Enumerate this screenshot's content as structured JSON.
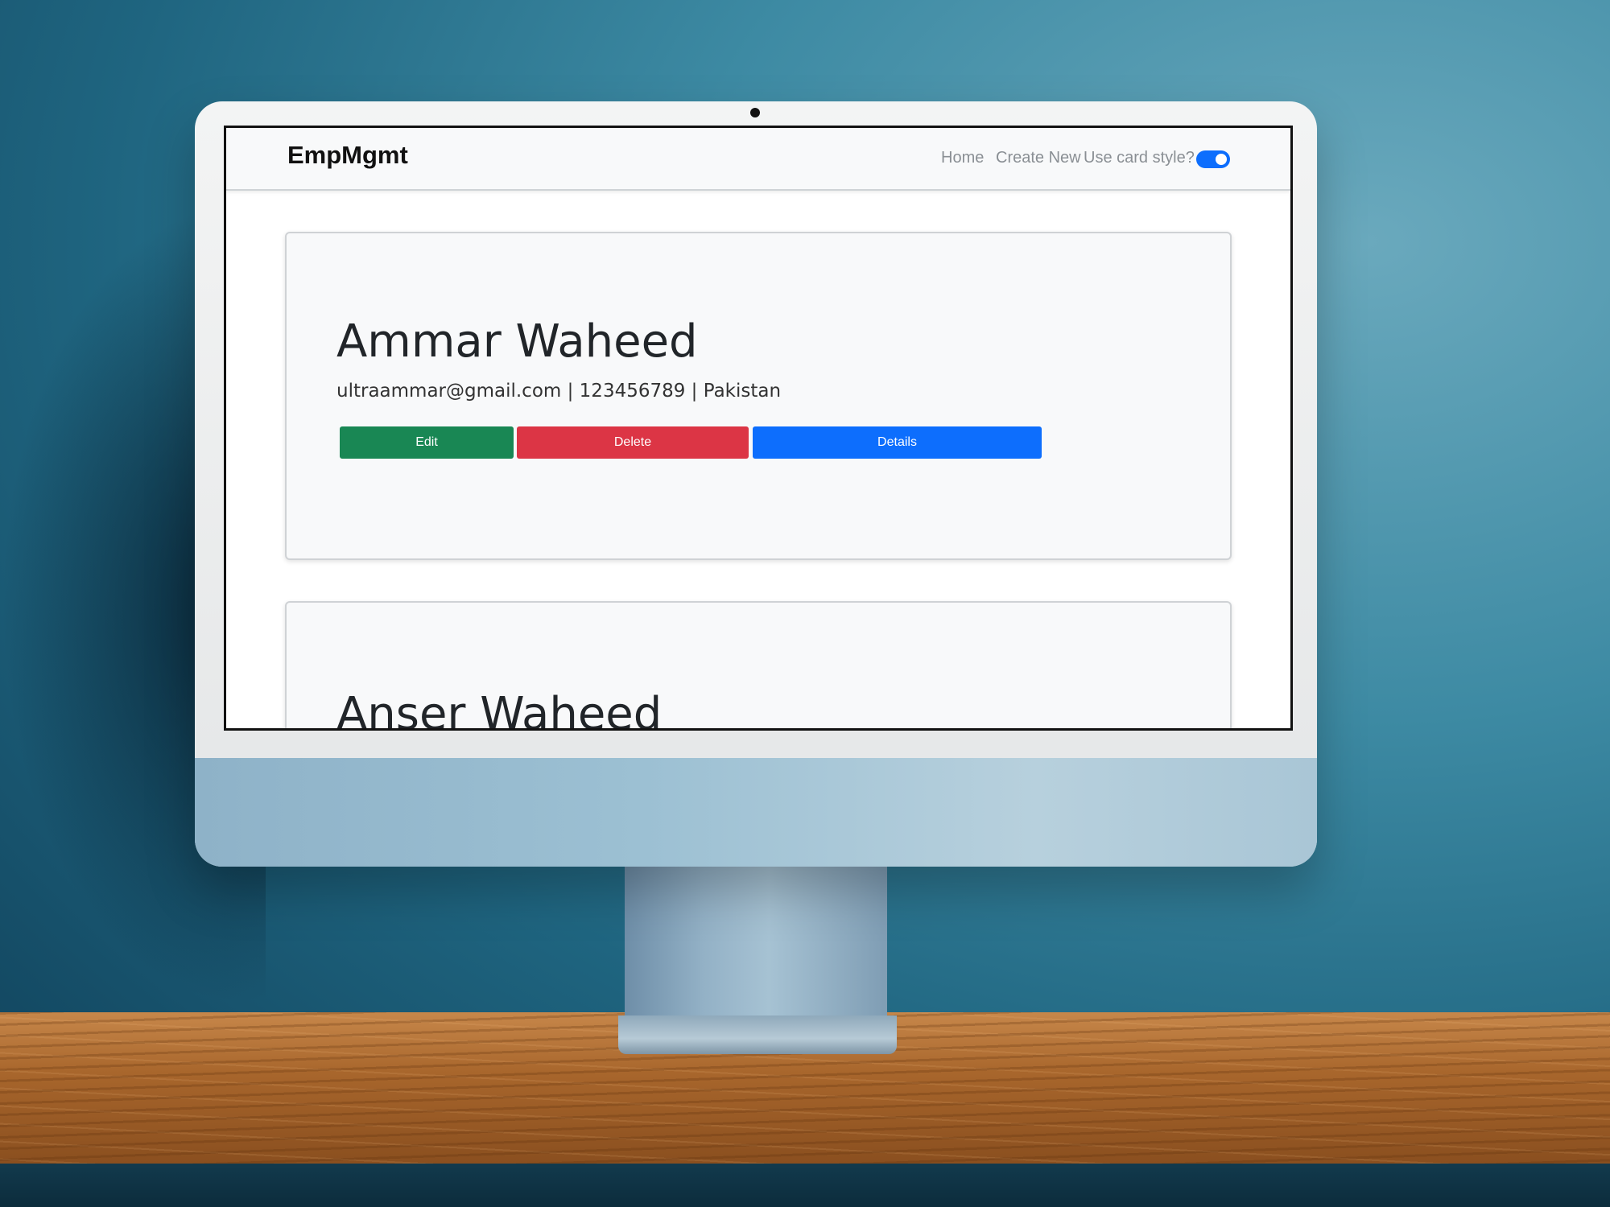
{
  "app": {
    "brand": "EmpMgmt",
    "nav": {
      "home": "Home",
      "create_new": "Create New",
      "card_style_label": "Use card style?",
      "card_style_on": true
    }
  },
  "employees": [
    {
      "name": "Ammar Waheed",
      "info": "ultraammar@gmail.com | 123456789 | Pakistan",
      "actions": {
        "edit": "Edit",
        "delete": "Delete",
        "details": "Details"
      }
    },
    {
      "name": "Anser Waheed"
    }
  ],
  "colors": {
    "edit": "#198754",
    "delete": "#dc3545",
    "details": "#0d6efd",
    "toggle": "#0d6efd"
  }
}
